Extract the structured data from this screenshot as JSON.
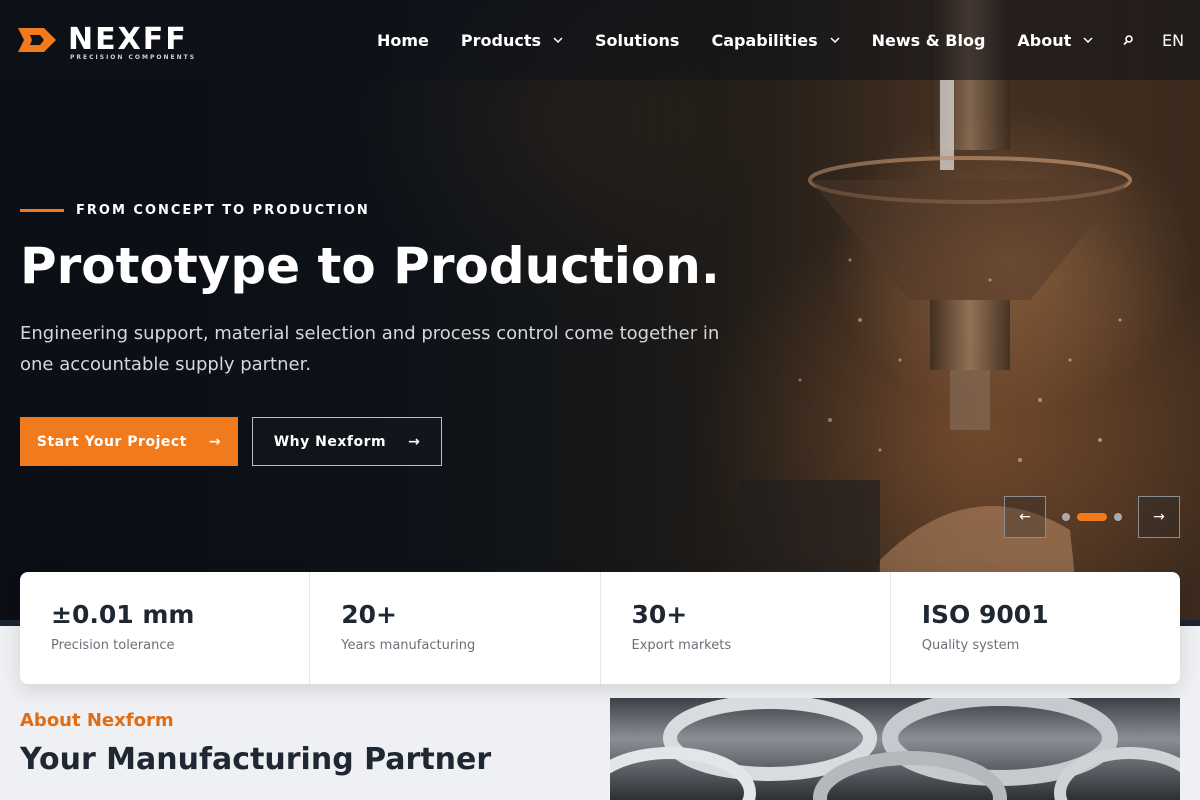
{
  "header": {
    "logo_text": "NEXFF",
    "logo_sub": "PRECISION COMPONENTS",
    "nav": [
      {
        "label": "Home",
        "has_menu": false
      },
      {
        "label": "Products",
        "has_menu": true
      },
      {
        "label": "Solutions",
        "has_menu": false
      },
      {
        "label": "Capabilities",
        "has_menu": true
      },
      {
        "label": "News & Blog",
        "has_menu": false
      },
      {
        "label": "About",
        "has_menu": true
      }
    ],
    "search_icon": "search-icon",
    "language": "EN"
  },
  "hero": {
    "eyebrow": "FROM CONCEPT TO PRODUCTION",
    "headline": "Prototype to Production.",
    "lede": "Engineering support, material selection and process control come together in one accountable supply partner.",
    "primary_cta": "Start Your Project",
    "secondary_cta": "Why Nexform",
    "cta_arrow": "→",
    "prev_arrow": "←",
    "next_arrow": "→",
    "slides_total": 3,
    "slide_active": 2
  },
  "stats": [
    {
      "value": "±0.01 mm",
      "label": "Precision tolerance"
    },
    {
      "value": "20+",
      "label": "Years manufacturing"
    },
    {
      "value": "30+",
      "label": "Export markets"
    },
    {
      "value": "ISO 9001",
      "label": "Quality system"
    }
  ],
  "about": {
    "kicker": "About Nexform",
    "title": "Your Manufacturing Partner"
  },
  "colors": {
    "accent": "#f07a1c",
    "dark": "#1f2733"
  }
}
